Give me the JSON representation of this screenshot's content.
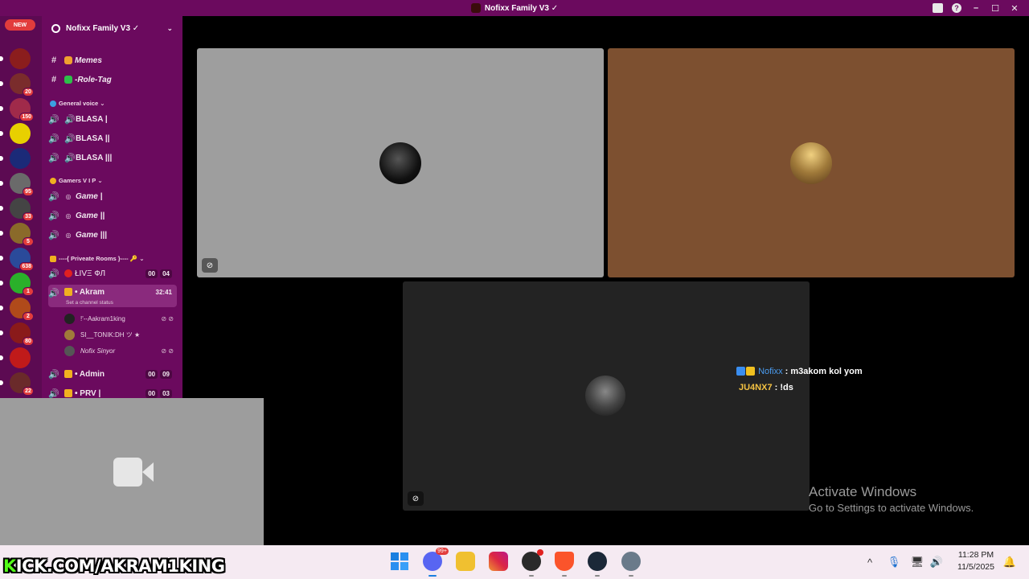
{
  "window": {
    "title": "Nofixx Family V3 ✓"
  },
  "rail": {
    "new_label": "NEW",
    "servers": [
      {
        "color": "#8b1d1d",
        "badge": ""
      },
      {
        "color": "#7a2c2c",
        "badge": "20"
      },
      {
        "color": "#a02a4a",
        "badge": "150"
      },
      {
        "color": "#e8d000",
        "badge": ""
      },
      {
        "color": "#1b2a78",
        "badge": ""
      },
      {
        "color": "#6a6a6a",
        "badge": "95"
      },
      {
        "color": "#444444",
        "badge": "33"
      },
      {
        "color": "#8a6a2a",
        "badge": "5"
      },
      {
        "color": "#2a4a9a",
        "badge": "638"
      },
      {
        "color": "#2ab02a",
        "badge": "1"
      },
      {
        "color": "#b04a1a",
        "badge": "2"
      },
      {
        "color": "#8a1a1a",
        "badge": "80"
      },
      {
        "color": "#c01a1a",
        "badge": ""
      },
      {
        "color": "#6a2a2a",
        "badge": "22"
      }
    ]
  },
  "server": {
    "name": "Nofixx Family V3 ✓"
  },
  "channels": {
    "text": [
      {
        "label": "Memes",
        "emoji_color": "#f0a030"
      },
      {
        "label": "-Role-Tag",
        "emoji_color": "#2ec04a"
      }
    ],
    "cat_general": "General voice",
    "general_voice": [
      "BLASA |",
      "BLASA ||",
      "BLASA |||"
    ],
    "cat_gamers": "Gamers V I P",
    "gamers": [
      "Game |",
      "Game ||",
      "Game |||"
    ],
    "cat_private": "----{ Priveate Rooms }----",
    "live": {
      "label": "ŁIVΞ ФЛ",
      "c1": "00",
      "c2": "04"
    },
    "akram": {
      "label": "• Akram",
      "time": "32:41",
      "status": "Set a channel status"
    },
    "members": [
      "!'--Aakram1king",
      "SI__TONIK:DH ツ ★",
      "Nofix Sinyor"
    ],
    "admin": {
      "label": "• Admin",
      "c1": "00",
      "c2": "09"
    },
    "prv": {
      "label": "• PRV |",
      "c1": "00",
      "c2": "03"
    }
  },
  "tiles": {
    "colors": {
      "gray": "#9e9e9e",
      "brown": "#7d5030",
      "dark": "#232323"
    }
  },
  "chat": [
    {
      "name": "Nofixx",
      "text": " : m3akom kol yom"
    },
    {
      "name": "JU4NX7",
      "text": " : !ds"
    }
  ],
  "activation": {
    "line1": "Activate Windows",
    "line2": "Go to Settings to activate Windows."
  },
  "stream": {
    "kick": "KICK.COM/AKRAM1KING"
  },
  "taskbar": {
    "discord_badge": "99+",
    "time": "11:28 PM",
    "date": "11/5/2025"
  }
}
